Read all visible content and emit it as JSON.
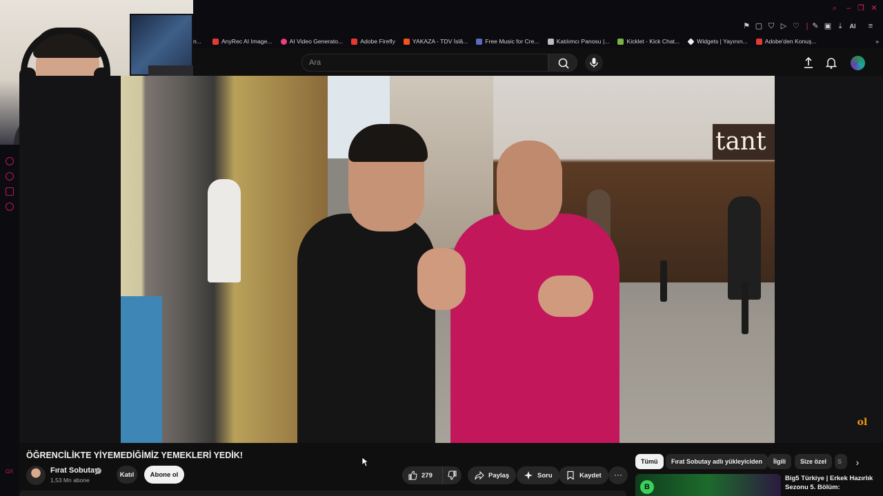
{
  "bookmarks": [
    {
      "label": "AnyRec AI Image...",
      "icon": "anyrec-favicon",
      "color": "#e53935"
    },
    {
      "label": "AI Video Generato...",
      "icon": "ai-video-favicon",
      "color": "#ec407a"
    },
    {
      "label": "Adobe Firefly",
      "icon": "adobe-favicon",
      "color": "#e53935"
    },
    {
      "label": "YAKAZA - TDV İslâ...",
      "icon": "yakaza-favicon",
      "color": "#f4511e"
    },
    {
      "label": "Free Music for Cre...",
      "icon": "music-favicon",
      "color": "#5c6bc0"
    },
    {
      "label": "Katılımcı Panosu |...",
      "icon": "panel-favicon",
      "color": "#bdbdbd"
    },
    {
      "label": "Kicklet - Kick Chat...",
      "icon": "kicklet-favicon",
      "color": "#7cb342"
    },
    {
      "label": "Widgets | Yayının...",
      "icon": "widgets-favicon",
      "color": "#eeeeee"
    },
    {
      "label": "Adobe'den Konuş...",
      "icon": "adobe-favicon",
      "color": "#e53935"
    }
  ],
  "bookmarks_truncated_left": "n...",
  "toolbar": {
    "ai_label": "AI"
  },
  "search": {
    "placeholder": "Ara"
  },
  "video": {
    "title": "ÖĞRENCİLİKTE YİYEMEDİĞİMİZ YEMEKLERİ YEDİK!",
    "watermark": "ol",
    "storefront_sign": "tant"
  },
  "channel": {
    "name": "Fırat Sobutay",
    "subscribers": "1,53 Mn abone",
    "join_label": "Katıl",
    "subscribe_label": "Abone ol"
  },
  "actions": {
    "likes": "279",
    "share_label": "Paylaş",
    "ask_label": "Soru",
    "save_label": "Kaydet"
  },
  "chips": [
    "Tümü",
    "Fırat Sobutay adlı yükleyiciden",
    "İlgili",
    "Size özel",
    "S"
  ],
  "recommendation": {
    "title_line1": "Big5 Türkiye | Erkek Hazırlık",
    "title_line2": "Sezonu 5. Bölüm:",
    "badge": "B"
  },
  "colors": {
    "accent": "#e0245e",
    "subscribe_bg": "#f1f1f1",
    "chip_bg": "#272727"
  }
}
